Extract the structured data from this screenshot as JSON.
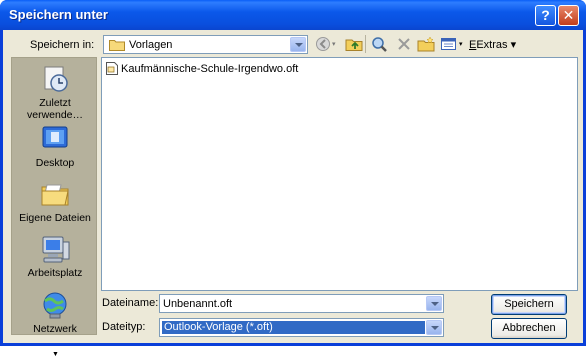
{
  "window": {
    "title": "Speichern unter"
  },
  "titlebar": {
    "help_glyph": "?",
    "close_glyph": "✕"
  },
  "toolbar": {
    "save_in_label": "Speichern in:",
    "save_in_value": "Vorlagen",
    "extras_label": "Extras ▾",
    "icons": [
      "back-icon",
      "up-folder-icon",
      "web-search-icon",
      "delete-icon",
      "new-folder-icon",
      "views-icon"
    ]
  },
  "places": [
    {
      "label": "Zuletzt verwende…",
      "icon": "recent-icon"
    },
    {
      "label": "Desktop",
      "icon": "desktop-icon"
    },
    {
      "label": "Eigene Dateien",
      "icon": "my-documents-icon"
    },
    {
      "label": "Arbeitsplatz",
      "icon": "my-computer-icon"
    },
    {
      "label": "Netzwerk",
      "icon": "network-icon"
    }
  ],
  "files": [
    {
      "name": "Kaufmännische-Schule-Irgendwo.oft",
      "icon": "template-file-icon"
    }
  ],
  "form": {
    "filename_label": "Dateiname:",
    "filename_value": "Unbenannt.oft",
    "filetype_label": "Dateityp:",
    "filetype_value": "Outlook-Vorlage (*.oft)"
  },
  "buttons": {
    "save": "Speichern",
    "cancel": "Abbrechen"
  },
  "colors": {
    "titlebar": "#0a58ea",
    "dialog_bg": "#ece9d8",
    "selection": "#316ac5",
    "places_bg": "#b5b19c"
  }
}
